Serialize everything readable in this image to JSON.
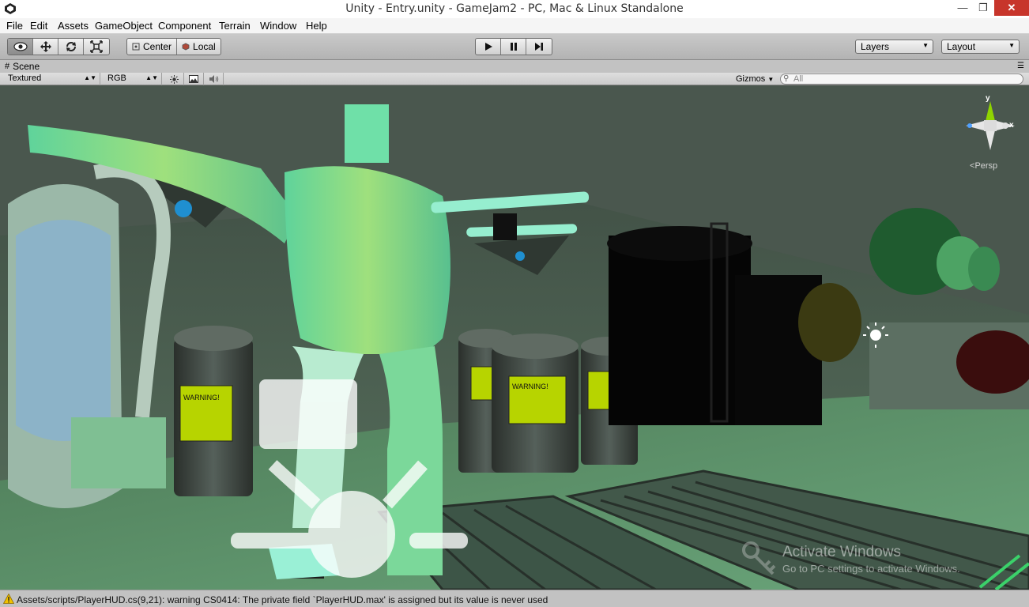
{
  "window": {
    "title": "Unity - Entry.unity - GameJam2 - PC, Mac & Linux Standalone",
    "min_glyph": "—",
    "max_glyph": "❐",
    "close_glyph": "✕"
  },
  "menu": [
    "File",
    "Edit",
    "Assets",
    "GameObject",
    "Component",
    "Terrain",
    "Window",
    "Help"
  ],
  "toolbar": {
    "transform_tools": [
      "view-tool",
      "move-tool",
      "rotate-tool",
      "scale-tool"
    ],
    "active_tool": "view-tool",
    "pivot_label": "Center",
    "space_label": "Local",
    "layers_label": "Layers",
    "layout_label": "Layout"
  },
  "scene": {
    "tab_label": "Scene",
    "render_mode": "Textured",
    "color_mode": "RGB",
    "gizmos_label": "Gizmos",
    "search_placeholder": "All",
    "projection_label": "Persp",
    "axis_y": "y",
    "axis_x": "x"
  },
  "watermark": {
    "title": "Activate Windows",
    "subtitle": "Go to PC settings to activate Windows."
  },
  "status": {
    "message": "Assets/scripts/PlayerHUD.cs(9,21): warning CS0414: The private field `PlayerHUD.max' is assigned but its value is never used"
  },
  "colors": {
    "viewport_bg": "#2d3a31",
    "character": "#6fe0a8",
    "warning_panel": "#b7d400",
    "accent_green": "#3bd16a"
  }
}
